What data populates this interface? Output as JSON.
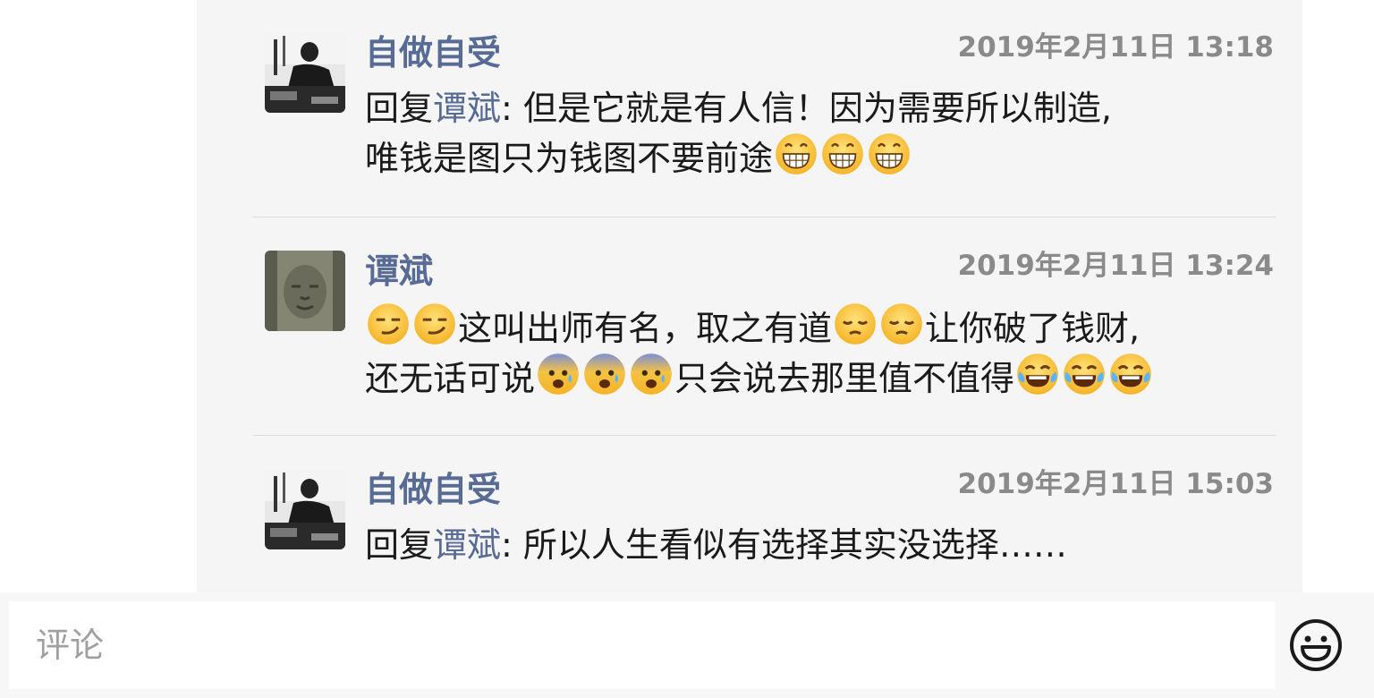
{
  "comments": [
    {
      "author": "自做自受",
      "time": "2019年2月11日 13:18",
      "reply_prefix": "回复",
      "reply_to": "谭斌",
      "text_line1": ": 但是它就是有人信！因为需要所以制造,",
      "text_line2": "唯钱是图只为钱图不要前途",
      "emoji": "grin-icon"
    },
    {
      "author": "谭斌",
      "time": "2019年2月11日 13:24",
      "seg1": "这叫出师有名，取之有道",
      "seg2": "让你破了钱财,",
      "seg3": "还无话可说",
      "seg4": "只会说去那里值不值得",
      "emojis": [
        "smirk-icon",
        "pensive-icon",
        "fearful-icon",
        "joy-tears-icon"
      ]
    },
    {
      "author": "自做自受",
      "time": "2019年2月11日 15:03",
      "reply_prefix": "回复",
      "reply_to": "谭斌",
      "text": ": 所以人生看似有选择其实没选择……"
    }
  ],
  "composer": {
    "placeholder": "评论",
    "emoji_button_icon": "smiley-face-icon"
  },
  "colors": {
    "link": "#576b95",
    "timestamp": "#8a8a8a",
    "panel": "#f5f5f5"
  }
}
